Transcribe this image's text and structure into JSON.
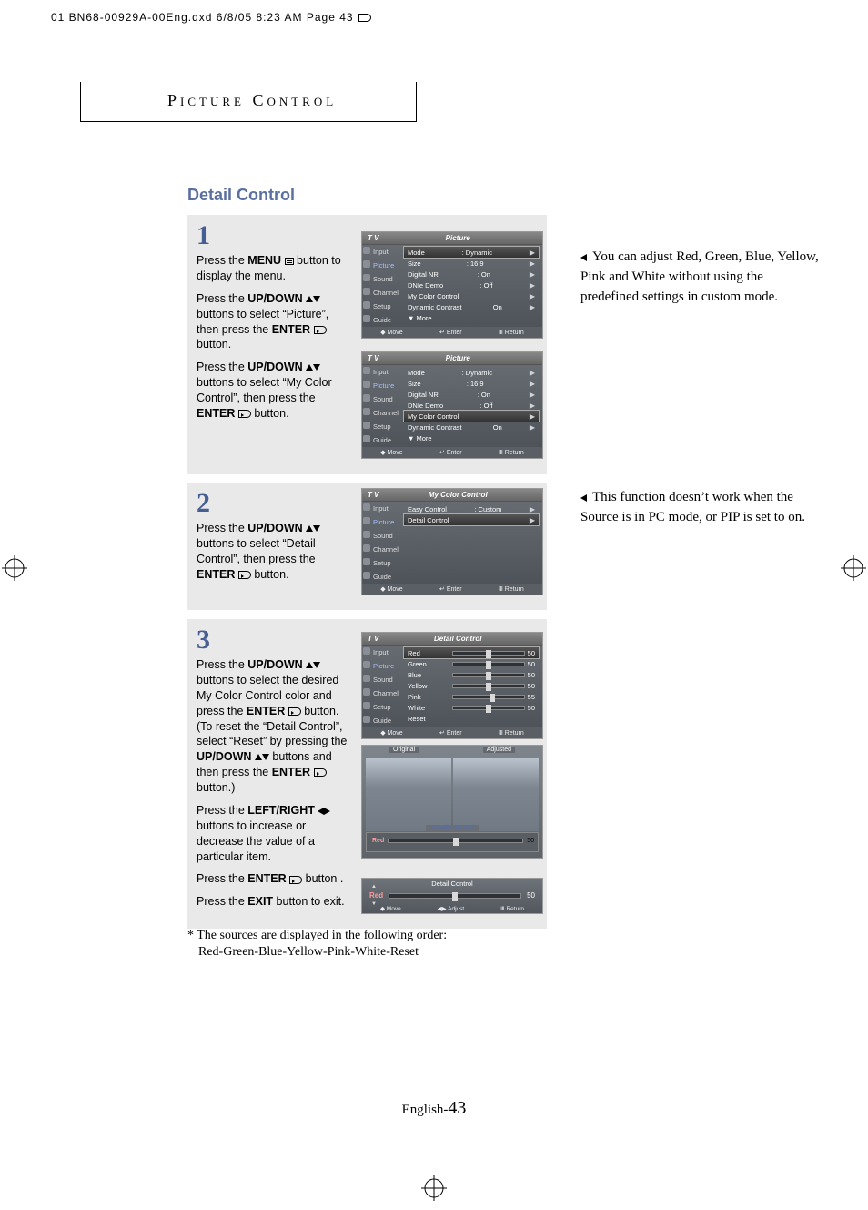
{
  "print_header": "01 BN68-00929A-00Eng.qxd  6/8/05 8:23 AM  Page 43",
  "chapter": "Picture Control",
  "title": "Detail Control",
  "step1": {
    "num": "1",
    "p1a": "Press the ",
    "p1b": "MENU",
    "p1c": " button to display the menu.",
    "p2a": "Press the ",
    "p2b": "UP/DOWN",
    "p2c": " buttons to select “Picture”, then press the ",
    "p2d": "ENTER",
    "p2e": " button.",
    "p3a": "Press the ",
    "p3b": "UP/DOWN",
    "p3c": " buttons to select “My Color Control”, then press the ",
    "p3d": "ENTER",
    "p3e": " button."
  },
  "step2": {
    "num": "2",
    "p1a": "Press the ",
    "p1b": "UP/DOWN",
    "p1c": " buttons to select “Detail Control”, then press the ",
    "p1d": "ENTER",
    "p1e": "  button."
  },
  "step3": {
    "num": "3",
    "p1a": "Press the ",
    "p1b": "UP/DOWN",
    "p1c": " buttons to select the desired My Color Control color and press the ",
    "p1d": "ENTER",
    "p1e": " button. (To reset the “Detail Control”, select “Reset” by pressing the ",
    "p1f": "UP/DOWN",
    "p1g": " buttons and then press the ",
    "p1h": "ENTER",
    "p1i": " button.)",
    "p2a": "Press the ",
    "p2b": "LEFT/RIGHT",
    "p2c": " buttons to increase or decrease the value of a particular item.",
    "p3a": "Press the ",
    "p3b": "ENTER",
    "p3c": "  button .",
    "p4a": "Press the ",
    "p4b": "EXIT",
    "p4c": " button to exit."
  },
  "notes": {
    "n1": "You can adjust Red, Green, Blue, Yellow, Pink and White without using the predefined settings in custom mode.",
    "n2": "This function doesn’t work when the Source is in PC mode, or PIP is set to on."
  },
  "order_note": "* The sources are displayed in the following order:",
  "order_list": "Red-Green-Blue-Yellow-Pink-White-Reset",
  "footer": {
    "lang": "English-",
    "page": "43"
  },
  "osd": {
    "tv": "T V",
    "sidebar": [
      "Input",
      "Picture",
      "Sound",
      "Channel",
      "Setup",
      "Guide"
    ],
    "foot_move": "Move",
    "foot_enter": "Enter",
    "foot_return": "Return",
    "foot_adjust": "Adjust",
    "picture1": {
      "title": "Picture",
      "rows": [
        {
          "label": "Mode",
          "value": ": Dynamic",
          "sel": true
        },
        {
          "label": "Size",
          "value": ": 16:9"
        },
        {
          "label": "Digital NR",
          "value": ": On"
        },
        {
          "label": "DNIe Demo",
          "value": ": Off"
        },
        {
          "label": "My Color Control",
          "value": ""
        },
        {
          "label": "Dynamic Contrast",
          "value": ": On"
        },
        {
          "label": "▼ More",
          "value": ""
        }
      ]
    },
    "picture2": {
      "title": "Picture",
      "rows": [
        {
          "label": "Mode",
          "value": ": Dynamic"
        },
        {
          "label": "Size",
          "value": ": 16:9"
        },
        {
          "label": "Digital NR",
          "value": ": On"
        },
        {
          "label": "DNIe Demo",
          "value": ": Off"
        },
        {
          "label": "My Color Control",
          "value": "",
          "sel": true
        },
        {
          "label": "Dynamic Contrast",
          "value": ": On"
        },
        {
          "label": "▼ More",
          "value": ""
        }
      ]
    },
    "mycolor": {
      "title": "My Color Control",
      "rows": [
        {
          "label": "Easy Control",
          "value": ": Custom"
        },
        {
          "label": "Detail Control",
          "value": "",
          "sel": true
        }
      ]
    },
    "detail": {
      "title": "Detail Control",
      "rows": [
        {
          "label": "Red",
          "value": "50",
          "sel": true,
          "slider": "mid"
        },
        {
          "label": "Green",
          "value": "50",
          "slider": "mid"
        },
        {
          "label": "Blue",
          "value": "50",
          "slider": "mid"
        },
        {
          "label": "Yellow",
          "value": "50",
          "slider": "mid"
        },
        {
          "label": "Pink",
          "value": "55",
          "slider": "m55"
        },
        {
          "label": "White",
          "value": "50",
          "slider": "mid"
        },
        {
          "label": "Reset",
          "value": ""
        }
      ]
    },
    "photo": {
      "orig": "Original",
      "adj": "Adjusted",
      "bar_title": "Detail Control",
      "bar_label": "Red",
      "bar_val": "50"
    },
    "strip": {
      "title": "Detail Control",
      "label": "Red",
      "val": "50"
    }
  }
}
